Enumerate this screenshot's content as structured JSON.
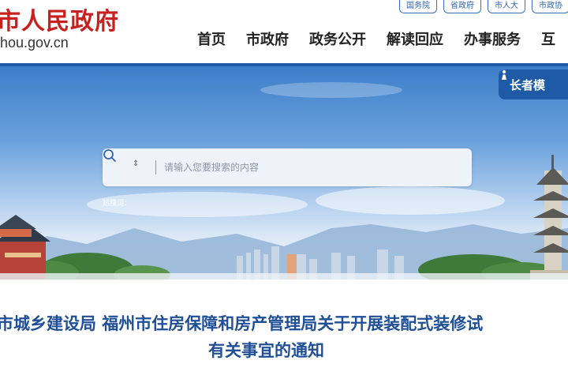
{
  "header": {
    "site_title": "市人民政府",
    "site_domain": "hou.gov.cn",
    "top_links": [
      "国务院",
      "省政府",
      "市人大",
      "市政协"
    ],
    "nav_items": [
      "首页",
      "市政府",
      "政务公开",
      "解读回应",
      "办事服务",
      "互"
    ]
  },
  "banner": {
    "elder_mode_label": "长者模",
    "search": {
      "select_indicator": "⇕",
      "placeholder": "请输入您要搜索的内容"
    },
    "hot_words_label": "热搜词："
  },
  "article": {
    "title_line1": "市城乡建设局 福州市住房保障和房产管理局关于开展装配式装修试",
    "title_line2": "有关事宜的通知"
  },
  "colors": {
    "brand_red": "#c81f1f",
    "nav_blue": "#1f5aa6",
    "title_blue": "#1f4f96"
  }
}
